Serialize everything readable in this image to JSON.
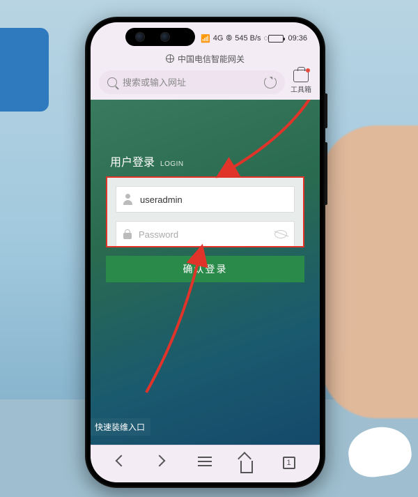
{
  "status": {
    "signal_text": "545 B/s",
    "network_icon": "4G",
    "time": "09:36"
  },
  "browser": {
    "page_title": "中国电信智能网关",
    "search_placeholder": "搜索或输入网址",
    "toolbox_label": "工具箱"
  },
  "login": {
    "title_cn": "用户登录",
    "title_en": "LOGIN",
    "username_value": "useradmin",
    "password_placeholder": "Password",
    "submit_label": "确认登录",
    "quick_link": "快速装维入口"
  },
  "navbar": {
    "tab_count": "1"
  },
  "colors": {
    "annotation_red": "#e0342a",
    "login_btn_green": "#2a8a4a"
  }
}
